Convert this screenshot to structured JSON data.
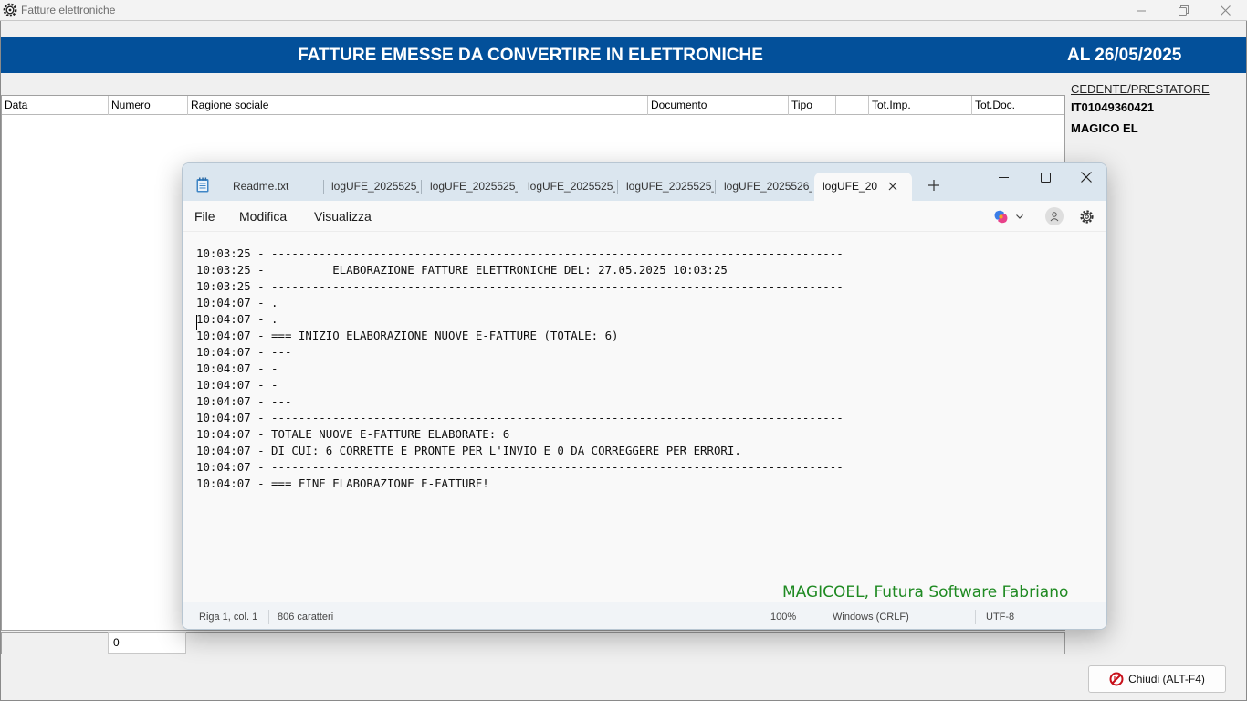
{
  "app": {
    "title": "Fatture elettroniche",
    "header_title": "FATTURE EMESSE DA CONVERTIRE IN ELETTRONICHE",
    "header_date": "AL 26/05/2025",
    "columns": [
      "Data",
      "Numero",
      "Ragione sociale",
      "Documento",
      "Tipo",
      "",
      "Tot.Imp.",
      "Tot.Doc."
    ],
    "cedente": {
      "label": "CEDENTE/PRESTATORE",
      "piva": "IT01049360421",
      "name": "MAGICO EL"
    },
    "count": "0",
    "close_button": "Chiudi (ALT-F4)",
    "colors": {
      "header_bg": "#03509a",
      "header_text": "#ffffff"
    }
  },
  "notepad": {
    "tabs": [
      "Readme.txt",
      "logUFE_2025525_",
      "logUFE_2025525_",
      "logUFE_2025525_",
      "logUFE_2025525_",
      "logUFE_2025526_"
    ],
    "active_tab": "logUFE_20",
    "menu": [
      "File",
      "Modifica",
      "Visualizza"
    ],
    "lines": [
      "10:03:25 - ------------------------------------------------------------------------------------",
      "10:03:25 -          ELABORAZIONE FATTURE ELETTRONICHE DEL: 27.05.2025 10:03:25",
      "10:03:25 - ------------------------------------------------------------------------------------",
      "10:04:07 - .",
      "10:04:07 - .",
      "10:04:07 - === INIZIO ELABORAZIONE NUOVE E-FATTURE (TOTALE: 6)",
      "10:04:07 - ---",
      "10:04:07 - -",
      "10:04:07 - -",
      "10:04:07 - ---",
      "10:04:07 - ------------------------------------------------------------------------------------",
      "10:04:07 - TOTALE NUOVE E-FATTURE ELABORATE: 6",
      "10:04:07 - DI CUI: 6 CORRETTE E PRONTE PER L'INVIO E 0 DA CORREGGERE PER ERRORI.",
      "10:04:07 - ------------------------------------------------------------------------------------",
      "10:04:07 - === FINE ELABORAZIONE E-FATTURE!"
    ],
    "watermark": "MAGICOEL, Futura Software Fabriano",
    "status": {
      "position": "Riga 1, col. 1",
      "chars": "806 caratteri",
      "zoom": "100%",
      "eol": "Windows (CRLF)",
      "encoding": "UTF-8"
    },
    "colors": {
      "watermark": "#1f8a22",
      "tabbar_bg": "#dbe6ef"
    },
    "icons": [
      "notepad-icon",
      "close-icon",
      "plus-icon",
      "minimize-icon",
      "maximize-icon",
      "copilot-icon",
      "chevron-down-icon",
      "account-icon",
      "gear-icon"
    ]
  }
}
